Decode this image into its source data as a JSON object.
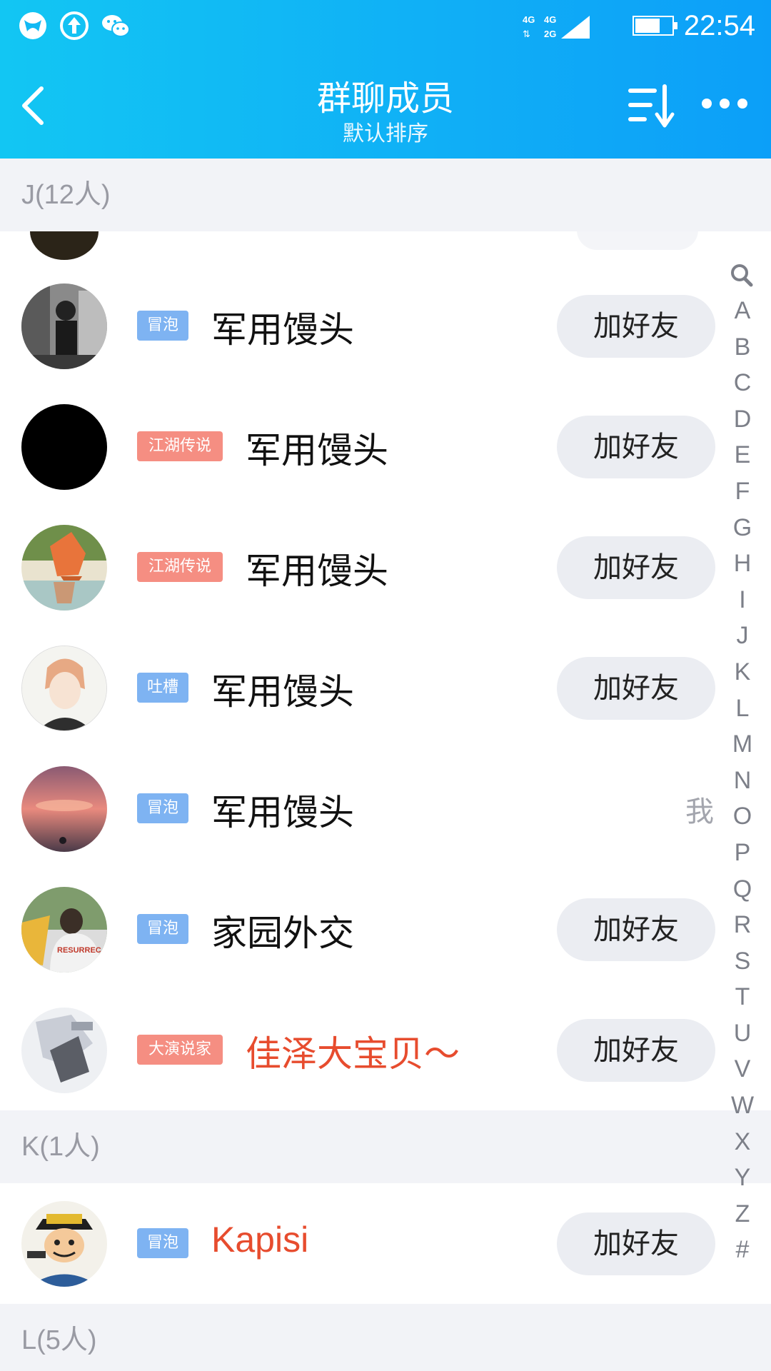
{
  "status_bar": {
    "time": "22:54",
    "network": "4G 4G 2G",
    "icons": [
      "vpn-icon",
      "upload-icon",
      "wechat-icon"
    ]
  },
  "header": {
    "title": "群聊成员",
    "subtitle": "默认排序",
    "back_icon": "back-chevron-icon",
    "sort_icon": "sort-icon",
    "more_icon": "more-dots-icon"
  },
  "sections": [
    {
      "header": "J(12人)",
      "members": [
        {
          "badge": "冒泡",
          "badge_type": "blue",
          "name": "军用馒头",
          "action": "加好友"
        },
        {
          "badge": "江湖传说",
          "badge_type": "red",
          "name": "军用馒头",
          "action": "加好友"
        },
        {
          "badge": "江湖传说",
          "badge_type": "red",
          "name": "军用馒头",
          "action": "加好友"
        },
        {
          "badge": "吐槽",
          "badge_type": "blue",
          "name": "军用馒头",
          "action": "加好友"
        },
        {
          "badge": "冒泡",
          "badge_type": "blue",
          "name": "军用馒头",
          "me": "我"
        },
        {
          "badge": "冒泡",
          "badge_type": "blue",
          "name": "家园外交",
          "action": "加好友"
        },
        {
          "badge": "大演说家",
          "badge_type": "red",
          "name": "佳泽大宝贝～",
          "name_color": "#e74c2e",
          "action": "加好友"
        }
      ]
    },
    {
      "header": "K(1人)",
      "members": [
        {
          "badge": "冒泡",
          "badge_type": "blue",
          "name": "Kapisi",
          "name_color": "#e74c2e",
          "action": "加好友"
        }
      ]
    },
    {
      "header": "L(5人)",
      "members": []
    }
  ],
  "index_bar": [
    "A",
    "B",
    "C",
    "D",
    "E",
    "F",
    "G",
    "H",
    "I",
    "J",
    "K",
    "L",
    "M",
    "N",
    "O",
    "P",
    "Q",
    "R",
    "S",
    "T",
    "U",
    "V",
    "W",
    "X",
    "Y",
    "Z",
    "#"
  ],
  "colors": {
    "header_gradient_start": "#12c6f3",
    "header_gradient_end": "#0c9ff8",
    "badge_blue": "#7eb3f2",
    "badge_red": "#f58e82",
    "name_highlight": "#e74c2e"
  }
}
